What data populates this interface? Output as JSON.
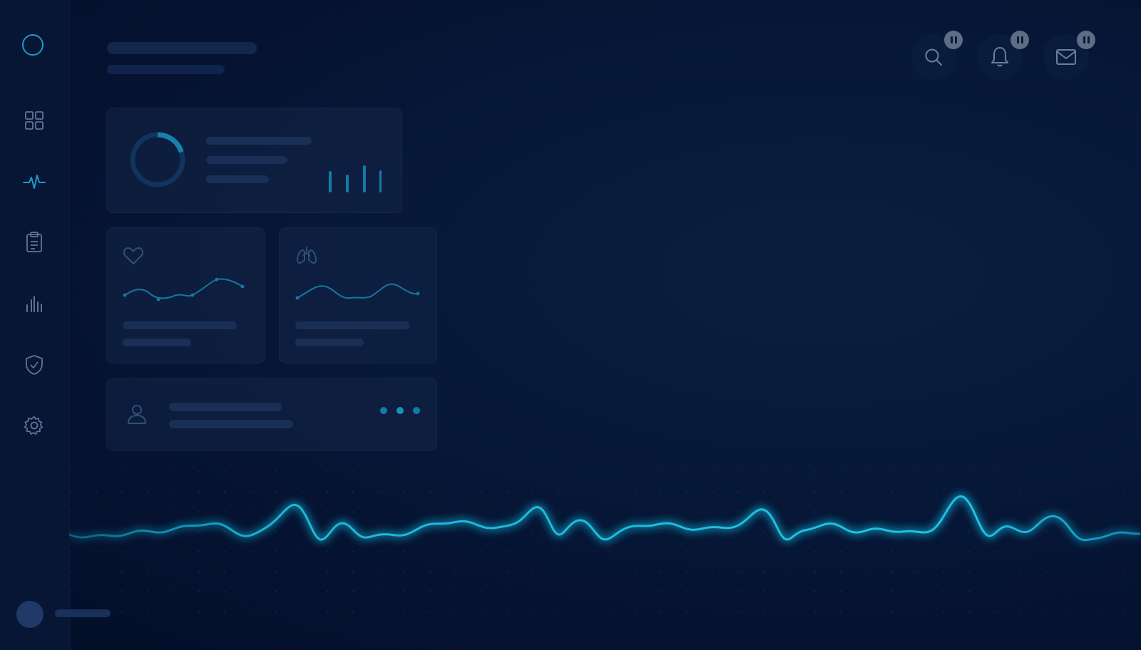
{
  "sidebar": {
    "items": [
      {
        "name": "dashboard",
        "icon": "grid-icon"
      },
      {
        "name": "activity",
        "icon": "pulse-icon",
        "active": true
      },
      {
        "name": "records",
        "icon": "clipboard-icon"
      },
      {
        "name": "analytics",
        "icon": "bar-chart-icon"
      },
      {
        "name": "security",
        "icon": "shield-check-icon"
      },
      {
        "name": "settings",
        "icon": "gear-icon"
      }
    ],
    "logo_icon": "circle-logo-icon",
    "user_avatar": "avatar"
  },
  "header": {
    "actions": [
      {
        "name": "search",
        "icon": "search-icon",
        "badge": "pause-icon"
      },
      {
        "name": "notifications",
        "icon": "bell-icon",
        "badge": "pause-icon"
      },
      {
        "name": "messages",
        "icon": "mail-icon",
        "badge": "pause-icon"
      }
    ]
  },
  "cards": {
    "summary": {
      "icons": [
        "progress-ring",
        "mini-bar-chart"
      ],
      "progress": 0.2
    },
    "heart": {
      "icon": "heart-icon"
    },
    "lungs": {
      "icon": "lungs-icon"
    },
    "patient": {
      "icon": "user-icon",
      "dots": 3
    }
  },
  "colors": {
    "background": "#051230",
    "sidebar": "#061634",
    "accent": "#1ec3e6",
    "accent_dim": "#1e8bb4",
    "card": "#16284c",
    "skeleton": "#1a2f56",
    "badge": "#5b6e86"
  }
}
